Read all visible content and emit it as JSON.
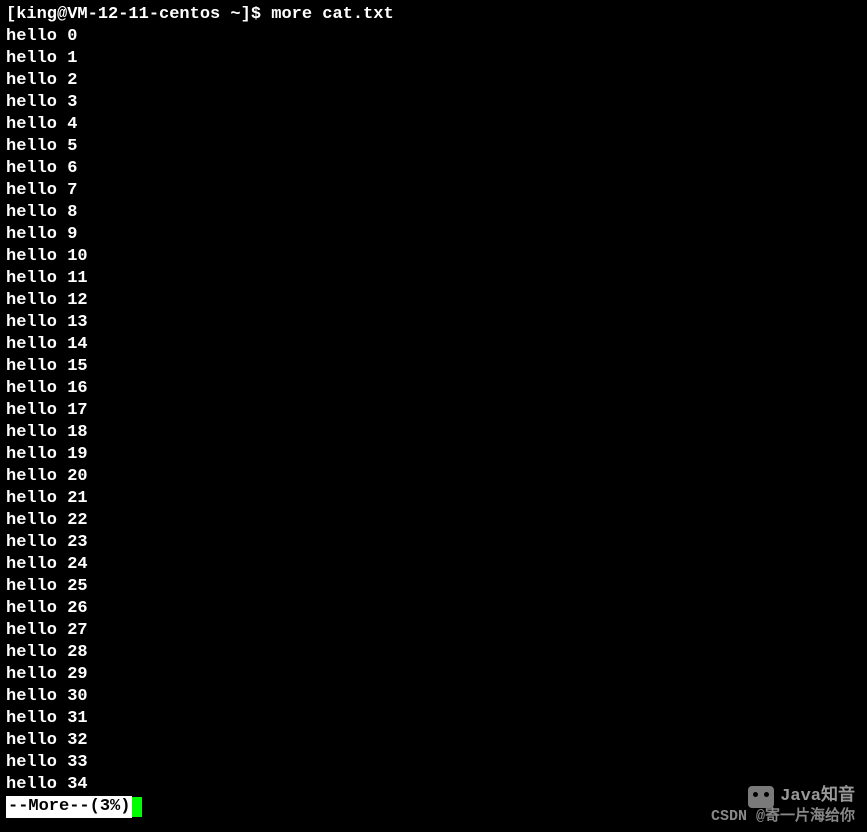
{
  "prompt": "[king@VM-12-11-centos ~]$ more cat.txt",
  "lines": [
    "hello 0",
    "hello 1",
    "hello 2",
    "hello 3",
    "hello 4",
    "hello 5",
    "hello 6",
    "hello 7",
    "hello 8",
    "hello 9",
    "hello 10",
    "hello 11",
    "hello 12",
    "hello 13",
    "hello 14",
    "hello 15",
    "hello 16",
    "hello 17",
    "hello 18",
    "hello 19",
    "hello 20",
    "hello 21",
    "hello 22",
    "hello 23",
    "hello 24",
    "hello 25",
    "hello 26",
    "hello 27",
    "hello 28",
    "hello 29",
    "hello 30",
    "hello 31",
    "hello 32",
    "hello 33",
    "hello 34"
  ],
  "status": "--More--(3%)",
  "watermarks": {
    "top": "Java知音",
    "bottom": "CSDN @寄一片海给你"
  }
}
